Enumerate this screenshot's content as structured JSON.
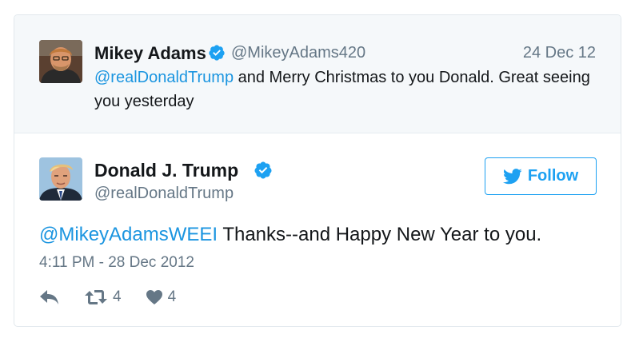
{
  "parent_tweet": {
    "author_name": "Mikey Adams",
    "author_handle": "@MikeyAdams420",
    "date": "24 Dec 12",
    "mention": "@realDonaldTrump",
    "text": " and Merry Christmas to you Donald. Great seeing you yesterday"
  },
  "tweet": {
    "author_name": "Donald J. Trump",
    "author_handle": "@realDonaldTrump",
    "follow_label": "Follow",
    "mention": "@MikeyAdamsWEEI",
    "text": " Thanks--and Happy New Year to you.",
    "timestamp": "4:11 PM - 28 Dec 2012",
    "retweet_count": "4",
    "like_count": "4"
  },
  "icons": {
    "verified": "verified-badge-icon",
    "follow": "twitter-bird-icon",
    "reply": "reply-arrow-icon",
    "retweet": "retweet-icon",
    "like": "heart-icon"
  },
  "colors": {
    "accent": "#1da1f2",
    "mention": "#1b95e0",
    "secondary_text": "#657786",
    "parent_background": "#f5f8fa",
    "border": "#e1e8ed"
  }
}
